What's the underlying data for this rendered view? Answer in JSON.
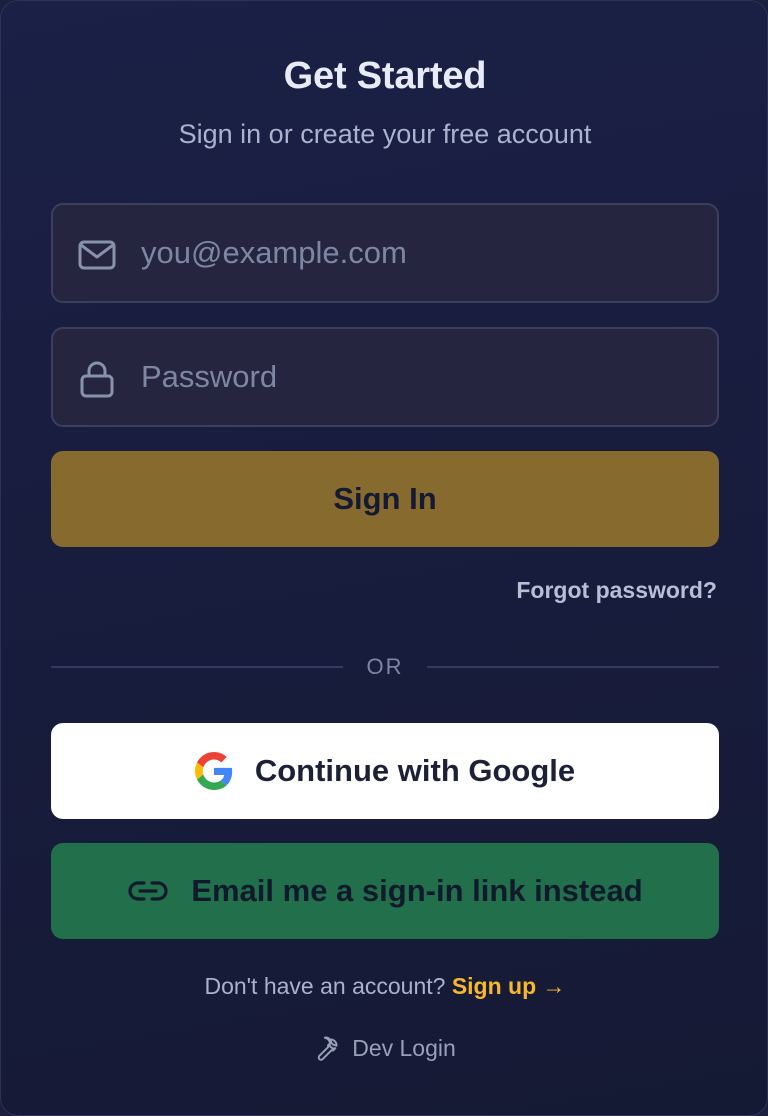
{
  "header": {
    "title": "Get Started",
    "subtitle": "Sign in or create your free account"
  },
  "form": {
    "email": {
      "placeholder": "you@example.com",
      "value": "",
      "icon": "mail-icon"
    },
    "password": {
      "placeholder": "Password",
      "value": "",
      "icon": "lock-icon"
    },
    "signin_label": "Sign In",
    "forgot_label": "Forgot password?"
  },
  "divider": {
    "label": "OR"
  },
  "oauth": {
    "google_label": "Continue with Google",
    "google_icon": "google-logo-icon",
    "magic_link_label": "Email me a sign-in link instead",
    "magic_link_icon": "link-icon"
  },
  "footer": {
    "signup_prompt": "Don't have an account?",
    "signup_label": "Sign up →",
    "dev_login_label": "Dev Login",
    "dev_login_icon": "wrench-icon"
  },
  "colors": {
    "background": "#1a1f3d",
    "accent_gold": "#876b2e",
    "accent_green": "#21704b",
    "link_yellow": "#f5b82e"
  }
}
